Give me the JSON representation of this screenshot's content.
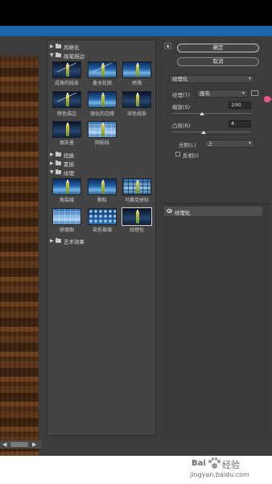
{
  "gallery": {
    "categories": {
      "stylize": "风格化",
      "brush_strokes": "画笔描边",
      "distort": "扭曲",
      "sketch": "素描",
      "texture": "纹理",
      "artistic": "艺术效果"
    },
    "brush_thumbs": [
      "成角的线条",
      "墨水轮廓",
      "喷溅",
      "喷色描边",
      "强化的边缘",
      "深色线条",
      "烟灰墨",
      "阴影线"
    ],
    "texture_thumbs": [
      "龟裂缝",
      "颗粒",
      "马赛克拼贴",
      "拼缀图",
      "染色玻璃",
      "纹理化"
    ]
  },
  "panel": {
    "ok_label": "确定",
    "cancel_label": "取消",
    "filter_select": "纹理化",
    "texture_label": "纹理(T)",
    "texture_value": "画布",
    "scale_label": "缩放(S)",
    "scale_value": "100",
    "relief_label": "凸现(R)",
    "relief_value": "4",
    "light_label": "光照(L)",
    "light_value": "上",
    "invert_label": "反相(I)"
  },
  "layers": {
    "active_layer": "纹理化"
  },
  "watermark": {
    "brand": "Bai",
    "brand_cn": "经验",
    "url": "jingyan.baidu.com"
  }
}
